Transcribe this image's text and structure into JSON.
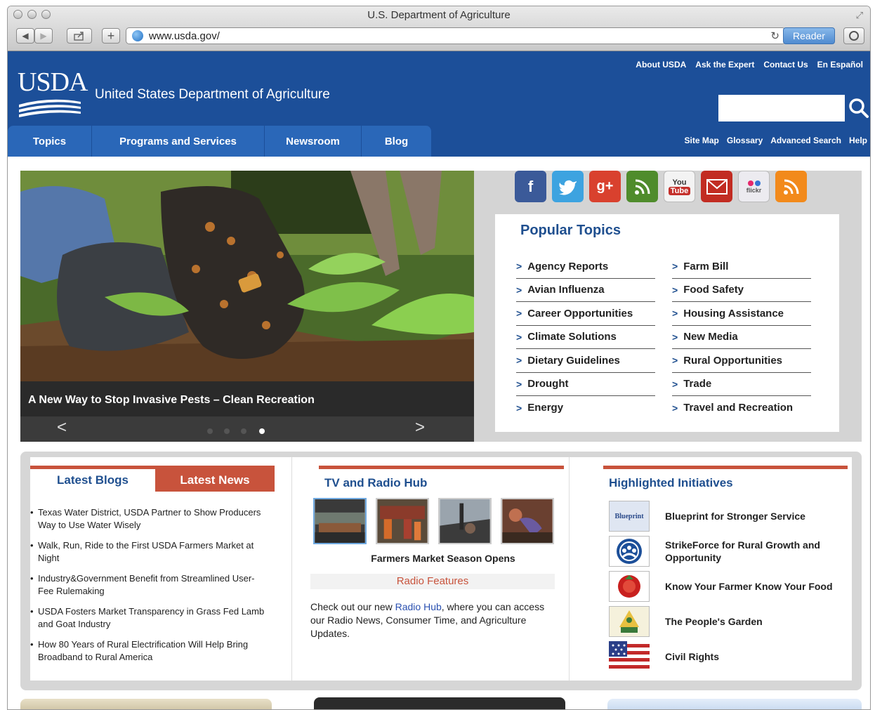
{
  "window": {
    "title": "U.S. Department of Agriculture"
  },
  "toolbar": {
    "address": "www.usda.gov/",
    "reader_label": "Reader",
    "back_icon": "back-arrow-icon",
    "forward_icon": "forward-arrow-icon",
    "share_icon": "share-icon",
    "add_icon": "plus-icon",
    "refresh_icon": "refresh-icon"
  },
  "header": {
    "logo_text": "USDA",
    "site_title": "United States Department of Agriculture",
    "utility_links": [
      "About USDA",
      "Ask the Expert",
      "Contact Us",
      "En Español"
    ],
    "search_placeholder": "",
    "nav_tabs": [
      "Topics",
      "Programs and Services",
      "Newsroom",
      "Blog"
    ],
    "secondary_links": [
      "Site Map",
      "Glossary",
      "Advanced Search",
      "Help"
    ],
    "colors": {
      "header_bg": "#1c4f99",
      "nav_tab": "#2a67b8",
      "accent": "#c8533c"
    }
  },
  "hero": {
    "caption": "A New Way to Stop Invasive Pests – Clean Recreation",
    "prev_label": "<",
    "next_label": ">",
    "slides_count": 4,
    "active_slide": 4
  },
  "social": [
    "facebook-icon",
    "twitter-icon",
    "google-plus-icon",
    "govdelivery-icon",
    "youtube-icon",
    "email-icon",
    "flickr-icon",
    "rss-icon"
  ],
  "social_labels": {
    "youtube_top": "You",
    "youtube_bottom": "Tube",
    "flickr": "flickr"
  },
  "popular_topics": {
    "title": "Popular Topics",
    "left": [
      "Agency Reports",
      "Avian Influenza",
      "Career Opportunities",
      "Climate Solutions",
      "Dietary Guidelines",
      "Drought",
      "Energy"
    ],
    "right": [
      "Farm Bill",
      "Food Safety",
      "Housing Assistance",
      "New Media",
      "Rural Opportunities",
      "Trade",
      "Travel and Recreation"
    ]
  },
  "blogs": {
    "tab_blogs": "Latest Blogs",
    "tab_news": "Latest News",
    "items": [
      "Texas Water District, USDA Partner to Show Producers Way to Use Water Wisely",
      "Walk, Run, Ride to the First USDA Farmers Market at Night",
      "Industry&Government Benefit from Streamlined User-Fee Rulemaking",
      "USDA Fosters Market Transparency in Grass Fed Lamb and Goat Industry",
      "How 80 Years of Rural Electrification Will Help Bring Broadband to Rural America"
    ]
  },
  "tv_radio": {
    "title": "TV and Radio Hub",
    "video_caption": "Farmers Market Season Opens",
    "radio_features": "Radio Features",
    "text_before": "Check out our new ",
    "link_text": "Radio Hub",
    "text_after": ", where you can access our Radio News, Consumer Time, and Agriculture Updates."
  },
  "initiatives": {
    "title": "Highlighted Initiatives",
    "items": [
      {
        "label": "Blueprint for Stronger Service",
        "icon": "blueprint-icon",
        "icon_text": "Blueprint"
      },
      {
        "label": "StrikeForce for Rural Growth and Opportunity",
        "icon": "strikeforce-icon"
      },
      {
        "label": "Know Your Farmer Know Your Food",
        "icon": "know-your-farmer-icon"
      },
      {
        "label": "The People's Garden",
        "icon": "peoples-garden-icon"
      },
      {
        "label": "Civil Rights",
        "icon": "civil-rights-flag-icon"
      }
    ]
  }
}
